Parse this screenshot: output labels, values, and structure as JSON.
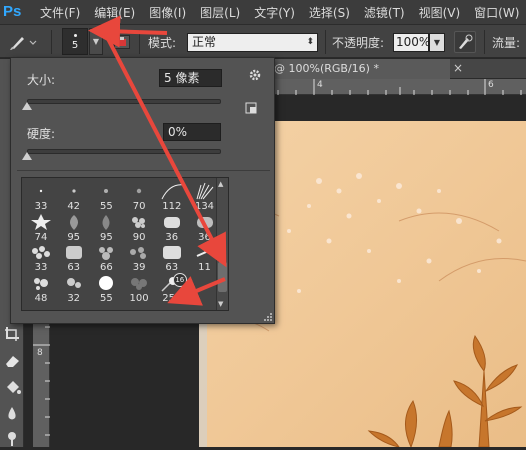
{
  "app": {
    "logo": "Ps"
  },
  "menu": [
    "文件(F)",
    "编辑(E)",
    "图像(I)",
    "图层(L)",
    "文字(Y)",
    "选择(S)",
    "滤镜(T)",
    "视图(V)",
    "窗口(W)"
  ],
  "options": {
    "brush_size": "5",
    "mode_label": "模式:",
    "mode_value": "正常",
    "opacity_label": "不透明度:",
    "opacity_value": "100%",
    "flow_label": "流量:"
  },
  "document": {
    "tab_title": "@ 100%(RGB/16) *",
    "tab_close": "×"
  },
  "rulers": {
    "h": [
      "4",
      "6"
    ],
    "v": [
      "8"
    ]
  },
  "brush_panel": {
    "size_label": "大小:",
    "size_value": "5 像素",
    "hardness_label": "硬度:",
    "hardness_value": "0%",
    "size_level": 0.0,
    "hardness_level": 0.0,
    "presets": [
      "33",
      "42",
      "55",
      "70",
      "112",
      "134",
      "74",
      "95",
      "95",
      "90",
      "36",
      "36",
      "33",
      "63",
      "66",
      "39",
      "63",
      "11",
      "48",
      "32",
      "55",
      "100",
      "250"
    ],
    "hover_badge": "16"
  },
  "annotation_color": "#e8473c"
}
